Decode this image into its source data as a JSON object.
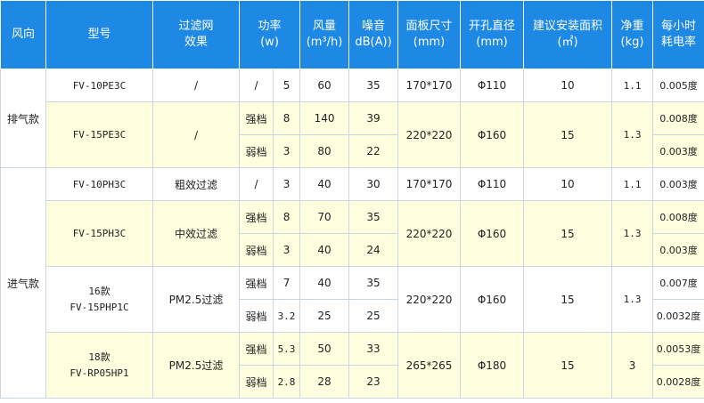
{
  "headers": {
    "direction": "风向",
    "model": "型号",
    "filter_line1": "过滤网",
    "filter_line2": "效果",
    "power_line1": "功率",
    "power_line2": "(w)",
    "airflow_line1": "风量",
    "airflow_line2": "(m³/h)",
    "noise_line1": "噪音",
    "noise_line2": "dB(A))",
    "panel_line1": "面板尺寸",
    "panel_line2": "(mm)",
    "opening_line1": "开孔直径",
    "opening_line2": "(mm)",
    "area_line1": "建议安装面积",
    "area_line2": "(㎡)",
    "weight_line1": "净重",
    "weight_line2": "(kg)",
    "consumption_line1": "每小时",
    "consumption_line2": "耗电率"
  },
  "groups": {
    "exhaust": "排气款",
    "intake": "进气款"
  },
  "rows": {
    "r1": {
      "model": "FV-10PE3C",
      "filter": "/",
      "gear": "/",
      "power": "5",
      "airflow": "60",
      "noise": "35",
      "panel": "170*170",
      "opening": "Φ110",
      "area": "10",
      "weight": "1.1",
      "consumption": "0.005度"
    },
    "r2": {
      "model": "FV-15PE3C",
      "filter": "/",
      "panel": "220*220",
      "opening": "Φ160",
      "area": "15",
      "weight": "1.3",
      "strong": {
        "gear": "强档",
        "power": "8",
        "airflow": "140",
        "noise": "39",
        "consumption": "0.008度"
      },
      "weak": {
        "gear": "弱档",
        "power": "3",
        "airflow": "80",
        "noise": "22",
        "consumption": "0.003度"
      }
    },
    "r3": {
      "model": "FV-10PH3C",
      "filter": "粗效过滤",
      "gear": "/",
      "power": "3",
      "airflow": "40",
      "noise": "30",
      "panel": "170*170",
      "opening": "Φ110",
      "area": "10",
      "weight": "1.1",
      "consumption": "0.003度"
    },
    "r4": {
      "model": "FV-15PH3C",
      "filter": "中效过滤",
      "panel": "220*220",
      "opening": "Φ160",
      "area": "15",
      "weight": "1.3",
      "strong": {
        "gear": "强档",
        "power": "8",
        "airflow": "70",
        "noise": "35",
        "consumption": "0.008度"
      },
      "weak": {
        "gear": "弱档",
        "power": "3",
        "airflow": "40",
        "noise": "24",
        "consumption": "0.003度"
      }
    },
    "r5": {
      "model_line1": "16款",
      "model_line2": "FV-15PHP1C",
      "filter": "PM2.5过滤",
      "panel": "220*220",
      "opening": "Φ160",
      "area": "15",
      "weight": "1.3",
      "strong": {
        "gear": "强档",
        "power": "7",
        "airflow": "40",
        "noise": "35",
        "consumption": "0.007度"
      },
      "weak": {
        "gear": "弱档",
        "power": "3.2",
        "airflow": "25",
        "noise": "25",
        "consumption": "0.0032度"
      }
    },
    "r6": {
      "model_line1": "18款",
      "model_line2": "FV-RP05HP1",
      "filter": "PM2.5过滤",
      "panel": "265*265",
      "opening": "Φ180",
      "area": "15",
      "weight": "3",
      "strong": {
        "gear": "强档",
        "power": "5.3",
        "airflow": "50",
        "noise": "33",
        "consumption": "0.0053度"
      },
      "weak": {
        "gear": "弱档",
        "power": "2.8",
        "airflow": "28",
        "noise": "23",
        "consumption": "0.0028度"
      }
    }
  }
}
